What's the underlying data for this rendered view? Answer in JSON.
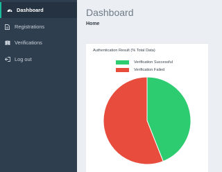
{
  "sidebar": {
    "items": [
      {
        "label": "Dashboard",
        "icon": "dashboard-icon",
        "active": true
      },
      {
        "label": "Registrations",
        "icon": "document-icon",
        "active": false
      },
      {
        "label": "Verifications",
        "icon": "book-icon",
        "active": false
      },
      {
        "label": "Log out",
        "icon": "logout-icon",
        "active": false
      }
    ]
  },
  "header": {
    "title": "Dashboard",
    "breadcrumb": "Home"
  },
  "colors": {
    "sidebar_bg": "#2f3e4e",
    "success": "#2ecc71",
    "failed": "#e74c3c",
    "accent": "#1abc9c"
  },
  "chart_data": {
    "type": "pie",
    "title": "Authentication Result (% Total Data)",
    "categories": [
      "Verification Successful",
      "Verification Failed"
    ],
    "values": [
      44,
      56
    ],
    "colors": [
      "#2ecc71",
      "#e74c3c"
    ],
    "legend": "top"
  }
}
